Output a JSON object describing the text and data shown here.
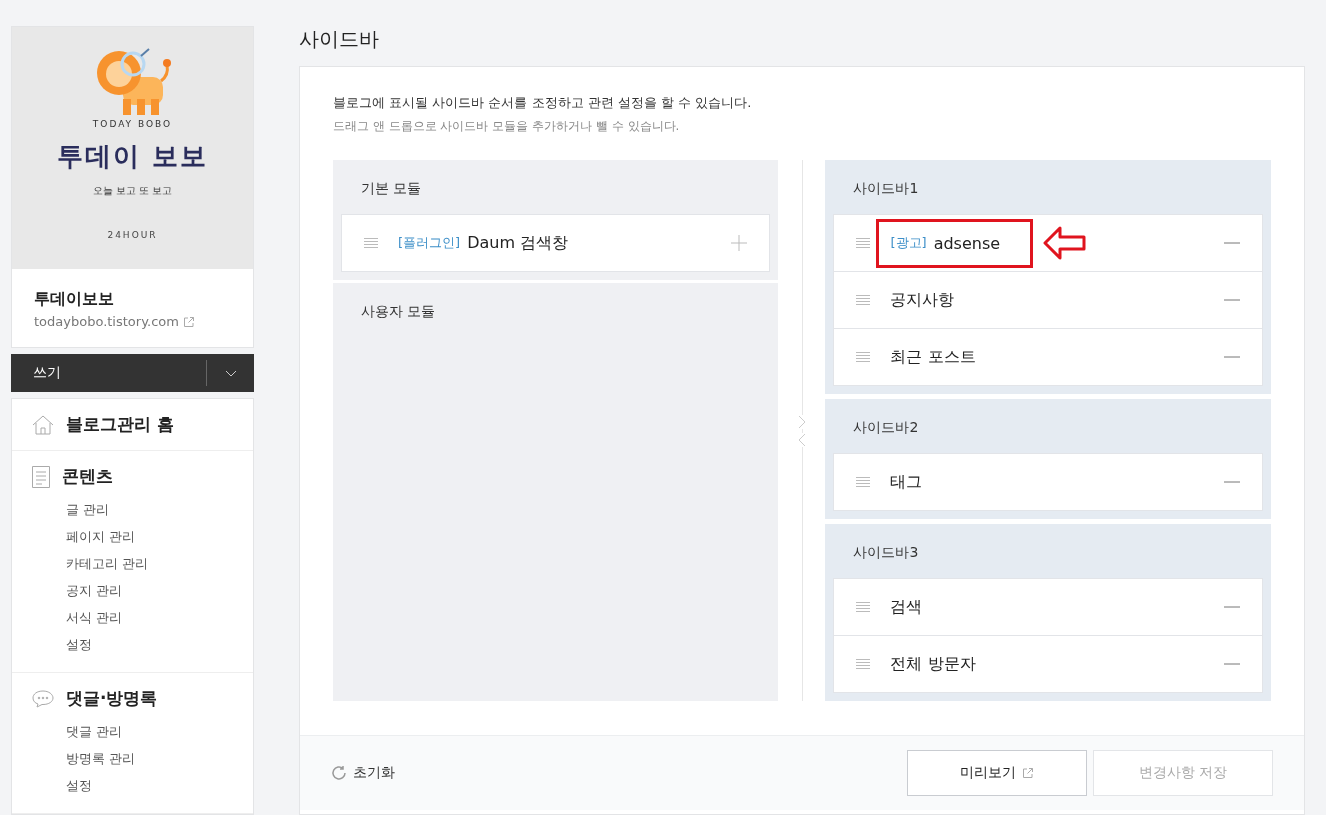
{
  "blog_card": {
    "logo": {
      "tagline_top": "TODAY BOBO",
      "title": "투데이 보보",
      "subtitle": "오늘 보고 또 보고",
      "footer": "24HOUR"
    },
    "name": "투데이보보",
    "url": "todaybobo.tistory.com"
  },
  "write_button": {
    "label": "쓰기"
  },
  "nav": [
    {
      "kind": "home",
      "label": "블로그관리 홈"
    },
    {
      "kind": "document",
      "label": "콘텐츠",
      "children": [
        {
          "label": "글 관리"
        },
        {
          "label": "페이지 관리"
        },
        {
          "label": "카테고리 관리"
        },
        {
          "label": "공지 관리"
        },
        {
          "label": "서식 관리"
        },
        {
          "label": "설정"
        }
      ]
    },
    {
      "kind": "comment",
      "label": "댓글·방명록",
      "children": [
        {
          "label": "댓글 관리"
        },
        {
          "label": "방명록 관리"
        },
        {
          "label": "설정"
        }
      ]
    }
  ],
  "page_title": "사이드바",
  "intro": {
    "main": "블로그에 표시될 사이드바 순서를 조정하고 관련 설정을 할 수 있습니다.",
    "hint": "드래그 앤 드롭으로 사이드바 모듈을 추가하거나 뺄 수 있습니다."
  },
  "module_groups": [
    {
      "title": "기본 모듈",
      "items": [
        {
          "tag": "[플러그인]",
          "name": "Daum 검색창"
        }
      ]
    },
    {
      "title": "사용자 모듈"
    }
  ],
  "sidebars": [
    {
      "title": "사이드바1",
      "items": [
        {
          "tag": "[광고]",
          "name": "adsense",
          "highlighted": true
        },
        {
          "name": "공지사항",
          "highlighted": false
        },
        {
          "name": "최근 포스트",
          "highlighted": false
        }
      ]
    },
    {
      "title": "사이드바2",
      "items": [
        {
          "name": "태그",
          "highlighted": false
        }
      ]
    },
    {
      "title": "사이드바3",
      "items": [
        {
          "name": "검색",
          "highlighted": false
        },
        {
          "name": "전체 방문자",
          "highlighted": false
        }
      ]
    }
  ],
  "footer": {
    "reset": "초기화",
    "preview": "미리보기",
    "save": {
      "label": "변경사항 저장",
      "disabled": true
    }
  }
}
